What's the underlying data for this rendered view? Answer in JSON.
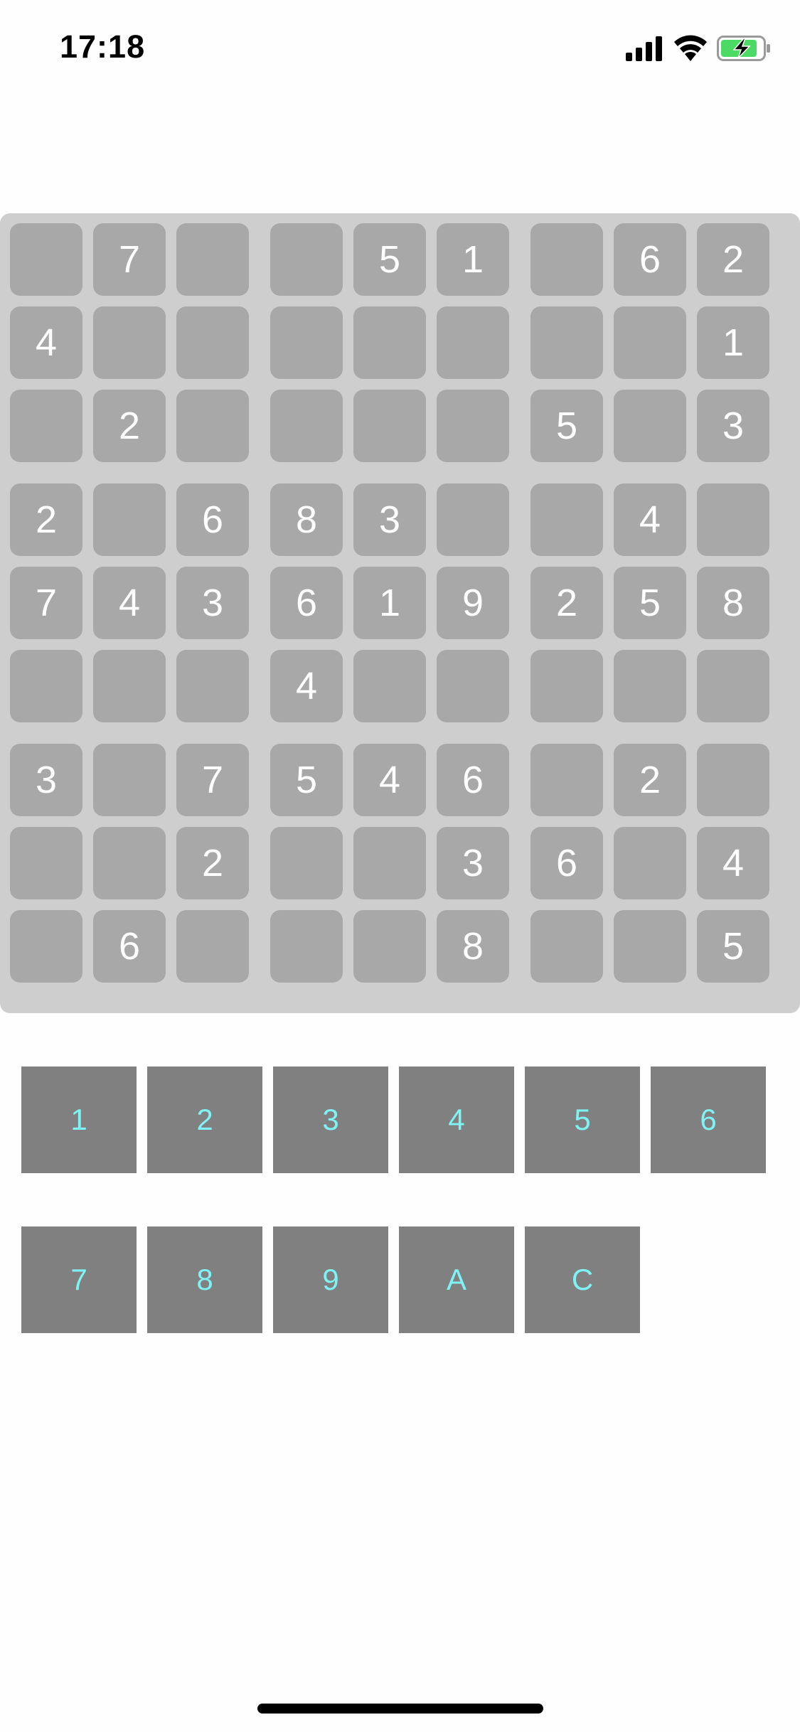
{
  "status_bar": {
    "time": "17:18",
    "icons": [
      "cellular-signal-icon",
      "wifi-icon",
      "battery-charging-icon"
    ],
    "battery_color": "#4cd964"
  },
  "board": {
    "rows": [
      [
        "",
        "7",
        "",
        "",
        "5",
        "1",
        "",
        "6",
        "2"
      ],
      [
        "4",
        "",
        "",
        "",
        "",
        "",
        "",
        "",
        "1"
      ],
      [
        "",
        "2",
        "",
        "",
        "",
        "",
        "5",
        "",
        "3"
      ],
      [
        "2",
        "",
        "6",
        "8",
        "3",
        "",
        "",
        "4",
        ""
      ],
      [
        "7",
        "4",
        "3",
        "6",
        "1",
        "9",
        "2",
        "5",
        "8"
      ],
      [
        "",
        "",
        "",
        "4",
        "",
        "",
        "",
        "",
        ""
      ],
      [
        "3",
        "",
        "7",
        "5",
        "4",
        "6",
        "",
        "2",
        ""
      ],
      [
        "",
        "",
        "2",
        "",
        "",
        "3",
        "6",
        "",
        "4"
      ],
      [
        "",
        "6",
        "",
        "",
        "",
        "8",
        "",
        "",
        "5"
      ]
    ],
    "colors": {
      "board_background": "#cecece",
      "cell_background": "#a8a8a8",
      "cell_text": "#ffffff"
    }
  },
  "keypad": {
    "rows": [
      [
        "1",
        "2",
        "3",
        "4",
        "5",
        "6"
      ],
      [
        "7",
        "8",
        "9",
        "A",
        "C"
      ]
    ],
    "colors": {
      "key_background": "#808080",
      "key_text": "#7ff3f3"
    }
  }
}
